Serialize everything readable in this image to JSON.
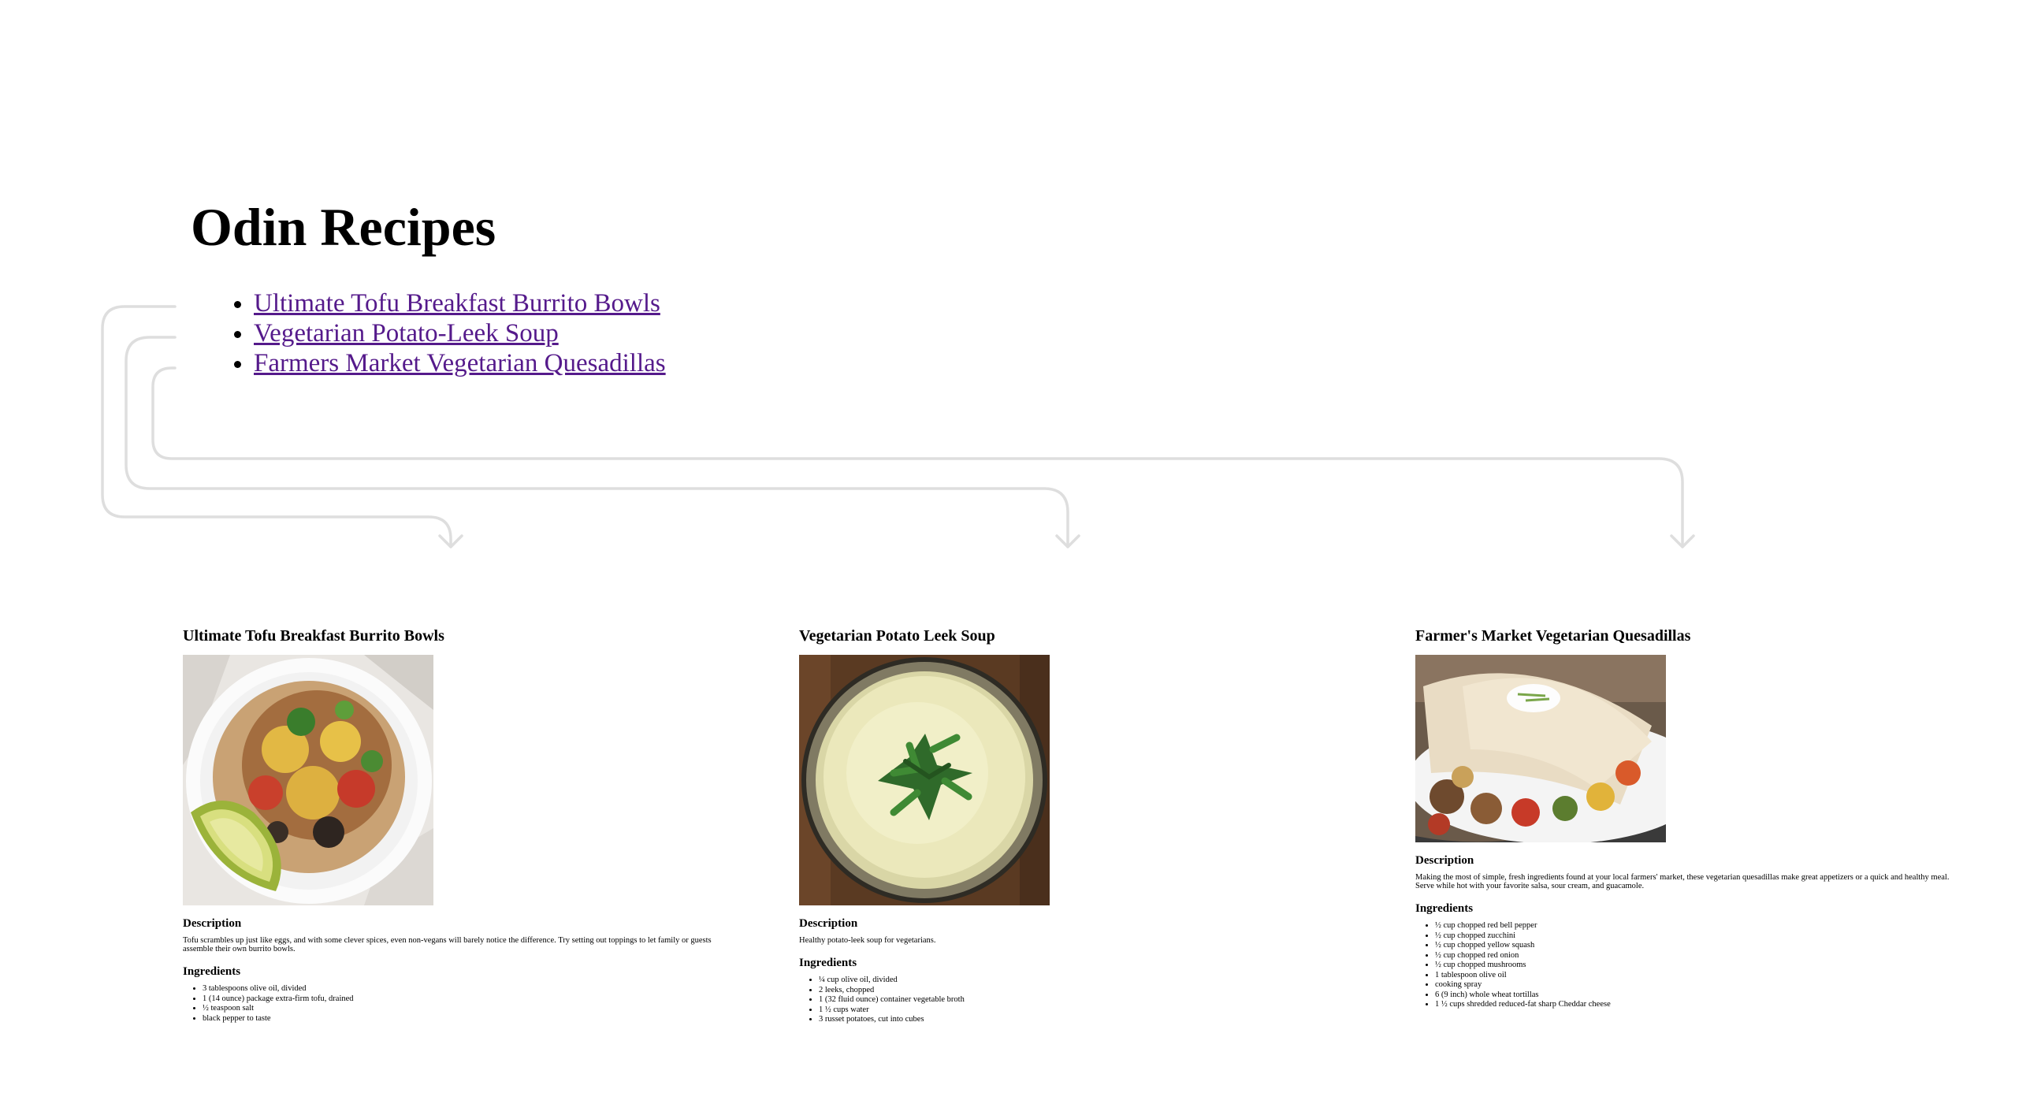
{
  "page": {
    "title": "Odin Recipes"
  },
  "nav": {
    "links": [
      "Ultimate Tofu Breakfast Burrito Bowls",
      "Vegetarian Potato-Leek Soup",
      "Farmers Market Vegetarian Quesadillas"
    ]
  },
  "colors": {
    "link_visited": "#551a8b",
    "connector": "#dedede"
  },
  "recipes": [
    {
      "title": "Ultimate Tofu Breakfast Burrito Bowls",
      "description_heading": "Description",
      "description": "Tofu scrambles up just like eggs, and with some clever spices, even non-vegans will barely notice the difference. Try setting out toppings to let family or guests assemble their own burrito bowls.",
      "ingredients_heading": "Ingredients",
      "ingredients": [
        "3 tablespoons olive oil, divided",
        "1 (14 ounce) package extra-firm tofu, drained",
        "½ teaspoon salt",
        "black pepper to taste"
      ]
    },
    {
      "title": "Vegetarian Potato Leek Soup",
      "description_heading": "Description",
      "description": "Healthy potato-leek soup for vegetarians.",
      "ingredients_heading": "Ingredients",
      "ingredients": [
        "¼ cup olive oil, divided",
        "2 leeks, chopped",
        "1 (32 fluid ounce) container vegetable broth",
        "1 ½ cups water",
        "3 russet potatoes, cut into cubes"
      ]
    },
    {
      "title": "Farmer's Market Vegetarian Quesadillas",
      "description_heading": "Description",
      "description": "Making the most of simple, fresh ingredients found at your local farmers' market, these vegetarian quesadillas make great appetizers or a quick and healthy meal. Serve while hot with your favorite salsa, sour cream, and guacamole.",
      "ingredients_heading": "Ingredients",
      "ingredients": [
        "½ cup chopped red bell pepper",
        "½ cup chopped zucchini",
        "½ cup chopped yellow squash",
        "½ cup chopped red onion",
        "½ cup chopped mushrooms",
        "1 tablespoon olive oil",
        "cooking spray",
        "6 (9 inch) whole wheat tortillas",
        "1 ½ cups shredded reduced-fat sharp Cheddar cheese"
      ]
    }
  ]
}
